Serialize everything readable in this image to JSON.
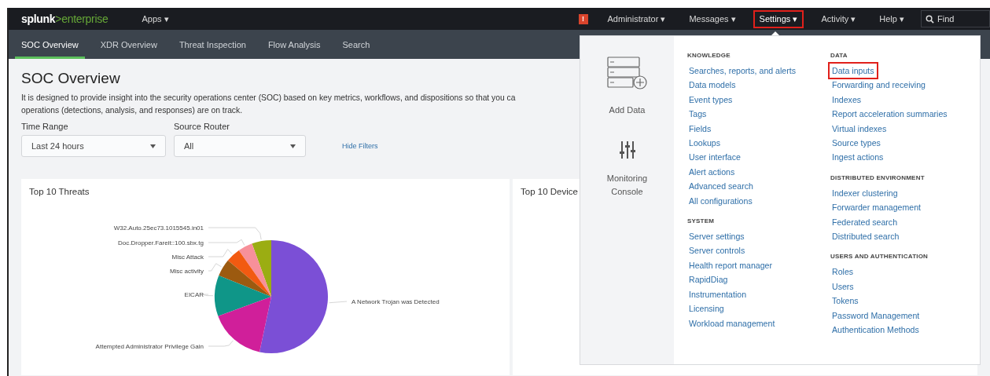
{
  "top_bar": {
    "logo": {
      "brand": "splunk",
      "product": ">enterprise"
    },
    "apps": "Apps ▾",
    "alert_badge": "!",
    "menus": [
      {
        "label": "Administrator ▾",
        "selected": false
      },
      {
        "label": "Messages ▾",
        "selected": false
      },
      {
        "label": "Settings ▾",
        "selected": true
      },
      {
        "label": "Activity ▾",
        "selected": false
      },
      {
        "label": "Help ▾",
        "selected": false
      }
    ],
    "search": {
      "placeholder": "Find"
    }
  },
  "tabs": [
    {
      "label": "SOC Overview",
      "selected": true
    },
    {
      "label": "XDR Overview",
      "selected": false
    },
    {
      "label": "Threat Inspection",
      "selected": false
    },
    {
      "label": "Flow Analysis",
      "selected": false
    },
    {
      "label": "Search",
      "selected": false
    }
  ],
  "page": {
    "title": "SOC Overview",
    "description_lines": [
      "It is designed to provide insight into the security operations center (SOC) based on key metrics, workflows, and dispositions so that you ca",
      "operations (detections, analysis, and responses) are on track."
    ],
    "filters": [
      {
        "label": "Time Range",
        "value": "Last 24 hours"
      },
      {
        "label": "Source Router",
        "value": "All"
      }
    ],
    "hide_filters": "Hide Filters"
  },
  "panels": [
    {
      "title": "Top 10 Threats",
      "slices": [
        {
          "label": "W32.Auto.25ec73.1015545.in01",
          "color": "#9bad12"
        },
        {
          "label": "Doc.Dropper.Fareit::100.sbx.tg",
          "color": "#f7909a"
        },
        {
          "label": "Misc Attack",
          "color": "#f25a11"
        },
        {
          "label": "Misc activity",
          "color": "#9c5a10"
        },
        {
          "label": "EICAR",
          "color": "#0f9688"
        },
        {
          "label": "A Network Trojan was Detected",
          "color": "#7b4fd6"
        },
        {
          "label": "Attempted Administrator Privilege Gain",
          "color": "#d01f9a"
        }
      ]
    },
    {
      "title": "Top 10 Device"
    }
  ],
  "settings_menu": {
    "shortcuts": [
      {
        "kind": "add-data",
        "label": "Add Data"
      },
      {
        "kind": "monitoring",
        "label": "Monitoring Console"
      }
    ],
    "columns": [
      [
        {
          "heading": "KNOWLEDGE",
          "items": [
            {
              "label": "Searches, reports, and alerts",
              "highlighted": false
            },
            {
              "label": "Data models",
              "highlighted": false
            },
            {
              "label": "Event types",
              "highlighted": false
            },
            {
              "label": "Tags",
              "highlighted": false
            },
            {
              "label": "Fields",
              "highlighted": false
            },
            {
              "label": "Lookups",
              "highlighted": false
            },
            {
              "label": "User interface",
              "highlighted": false
            },
            {
              "label": "Alert actions",
              "highlighted": false
            },
            {
              "label": "Advanced search",
              "highlighted": false
            },
            {
              "label": "All configurations",
              "highlighted": false
            }
          ]
        },
        {
          "heading": "SYSTEM",
          "items": [
            {
              "label": "Server settings",
              "highlighted": false
            },
            {
              "label": "Server controls",
              "highlighted": false
            },
            {
              "label": "Health report manager",
              "highlighted": false
            },
            {
              "label": "RapidDiag",
              "highlighted": false
            },
            {
              "label": "Instrumentation",
              "highlighted": false
            },
            {
              "label": "Licensing",
              "highlighted": false
            },
            {
              "label": "Workload management",
              "highlighted": false
            }
          ]
        }
      ],
      [
        {
          "heading": "DATA",
          "items": [
            {
              "label": "Data inputs",
              "highlighted": true
            },
            {
              "label": "Forwarding and receiving",
              "highlighted": false
            },
            {
              "label": "Indexes",
              "highlighted": false
            },
            {
              "label": "Report acceleration summaries",
              "highlighted": false
            },
            {
              "label": "Virtual indexes",
              "highlighted": false
            },
            {
              "label": "Source types",
              "highlighted": false
            },
            {
              "label": "Ingest actions",
              "highlighted": false
            }
          ]
        },
        {
          "heading": "DISTRIBUTED ENVIRONMENT",
          "items": [
            {
              "label": "Indexer clustering",
              "highlighted": false
            },
            {
              "label": "Forwarder management",
              "highlighted": false
            },
            {
              "label": "Federated search",
              "highlighted": false
            },
            {
              "label": "Distributed search",
              "highlighted": false
            }
          ]
        },
        {
          "heading": "USERS AND AUTHENTICATION",
          "items": [
            {
              "label": "Roles",
              "highlighted": false
            },
            {
              "label": "Users",
              "highlighted": false
            },
            {
              "label": "Tokens",
              "highlighted": false
            },
            {
              "label": "Password Management",
              "highlighted": false
            },
            {
              "label": "Authentication Methods",
              "highlighted": false
            }
          ]
        }
      ]
    ]
  }
}
